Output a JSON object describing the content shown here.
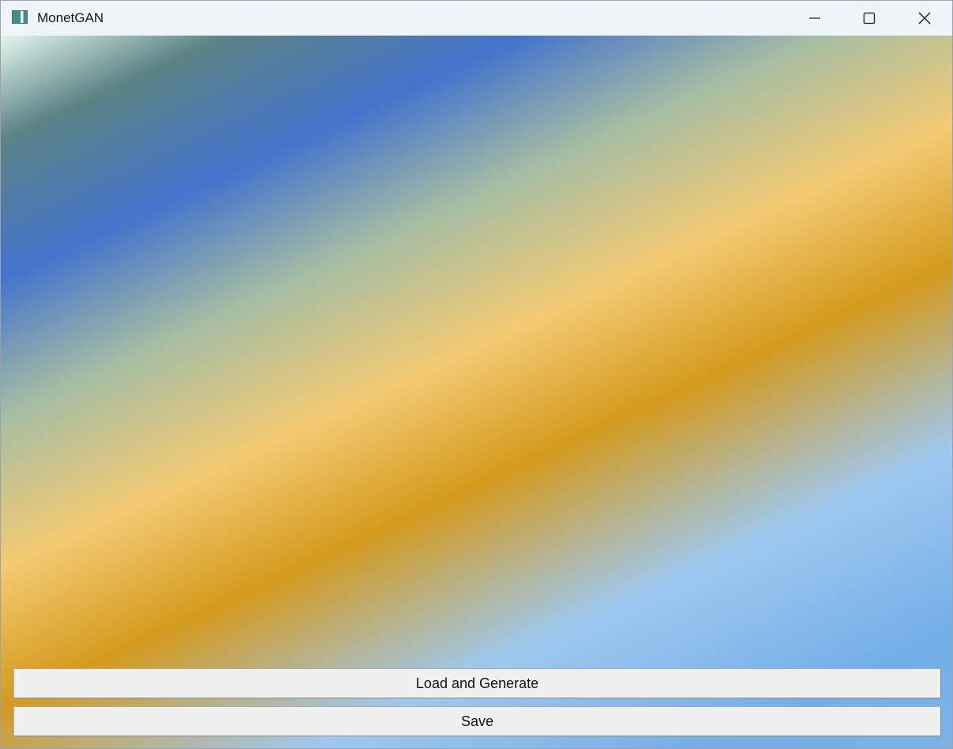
{
  "window": {
    "title": "MonetGAN"
  },
  "controls": {
    "minimize_icon": "minimize-icon",
    "maximize_icon": "maximize-icon",
    "close_icon": "close-icon"
  },
  "actions": {
    "load_label": "Load and Generate",
    "save_label": "Save"
  },
  "colors": {
    "titlebar": "#eff4f9",
    "button_bg": "#f0f0f0",
    "gradient": [
      "#e3f6ee",
      "#5c8385",
      "#4474cc",
      "#a6bda3",
      "#f3ca73",
      "#d49a1d",
      "#9ec8ef",
      "#73aee8"
    ]
  }
}
